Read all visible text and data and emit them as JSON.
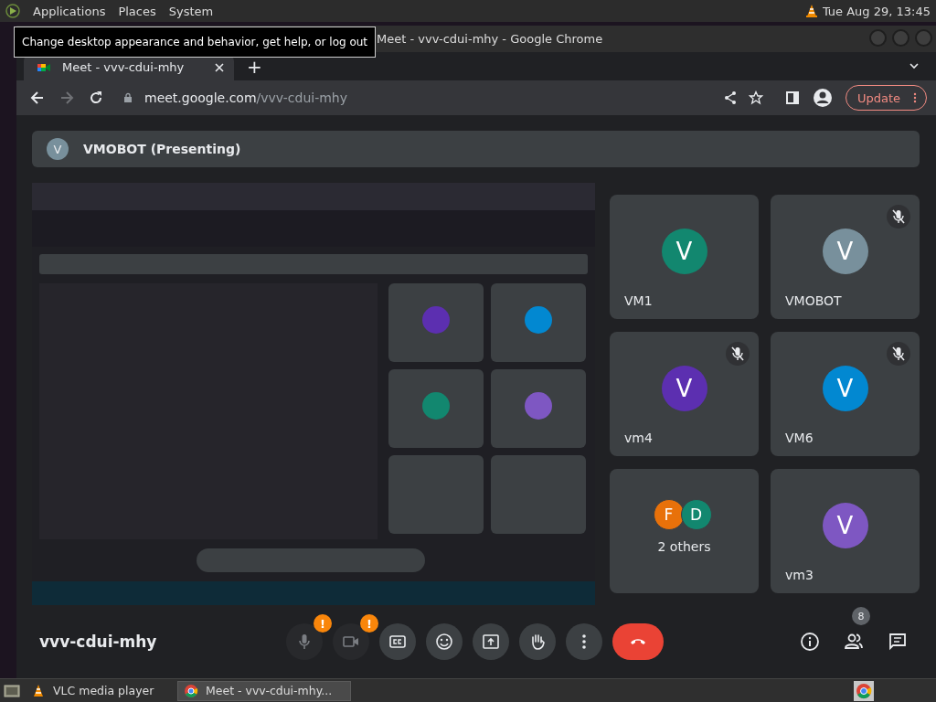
{
  "top_panel": {
    "menus": [
      {
        "label": "Applications"
      },
      {
        "label": "Places"
      },
      {
        "label": "System"
      }
    ],
    "clock": "Tue Aug 29, 13:45"
  },
  "tooltip": "Change desktop appearance and behavior, get help, or log out",
  "window": {
    "title": "Meet - vvv-cdui-mhy - Google Chrome"
  },
  "tabs": [
    {
      "label": "Meet - vvv-cdui-mhy",
      "selected": true
    }
  ],
  "new_tab": "+",
  "address": {
    "host": "meet.google.com",
    "path": "/vvv-cdui-mhy"
  },
  "update_button": "Update",
  "presenting_banner": {
    "initial": "V",
    "label": "VMOBOT (Presenting)"
  },
  "tiles": [
    {
      "kind": "person",
      "name": "VM1",
      "muted": false,
      "avatars": [
        {
          "letter": "V",
          "color": "#12876f"
        }
      ]
    },
    {
      "kind": "person",
      "name": "VMOBOT",
      "muted": true,
      "avatars": [
        {
          "letter": "V",
          "color": "#78909c"
        }
      ]
    },
    {
      "kind": "person",
      "name": "vm4",
      "muted": true,
      "avatars": [
        {
          "letter": "V",
          "color": "#5c2fb0"
        }
      ]
    },
    {
      "kind": "person",
      "name": "VM6",
      "muted": true,
      "avatars": [
        {
          "letter": "V",
          "color": "#0288d1"
        }
      ]
    },
    {
      "kind": "group",
      "name": "2 others",
      "muted": false,
      "avatars": [
        {
          "letter": "F",
          "color": "#e8710a"
        },
        {
          "letter": "D",
          "color": "#12876f"
        }
      ]
    },
    {
      "kind": "person",
      "name": "vm3",
      "muted": false,
      "avatars": [
        {
          "letter": "V",
          "color": "#7e57c2"
        }
      ]
    }
  ],
  "meeting_name": "vvv-cdui-mhy",
  "controls": [
    {
      "kind": "mic",
      "alert": "!",
      "disabled": true
    },
    {
      "kind": "camera",
      "alert": "!",
      "disabled": true
    },
    {
      "kind": "captions",
      "disabled": false
    },
    {
      "kind": "emoji",
      "disabled": false
    },
    {
      "kind": "present",
      "disabled": false
    },
    {
      "kind": "hand",
      "disabled": false
    },
    {
      "kind": "more",
      "disabled": false
    },
    {
      "kind": "end",
      "disabled": false
    }
  ],
  "side_controls": [
    {
      "kind": "info"
    },
    {
      "kind": "people",
      "badge": "8"
    },
    {
      "kind": "chat"
    }
  ],
  "taskbar": {
    "items": [
      {
        "kind": "vlc",
        "label": "VLC media player",
        "selected": false
      },
      {
        "kind": "chrome",
        "label": "Meet - vvv-cdui-mhy...",
        "selected": true
      }
    ]
  }
}
